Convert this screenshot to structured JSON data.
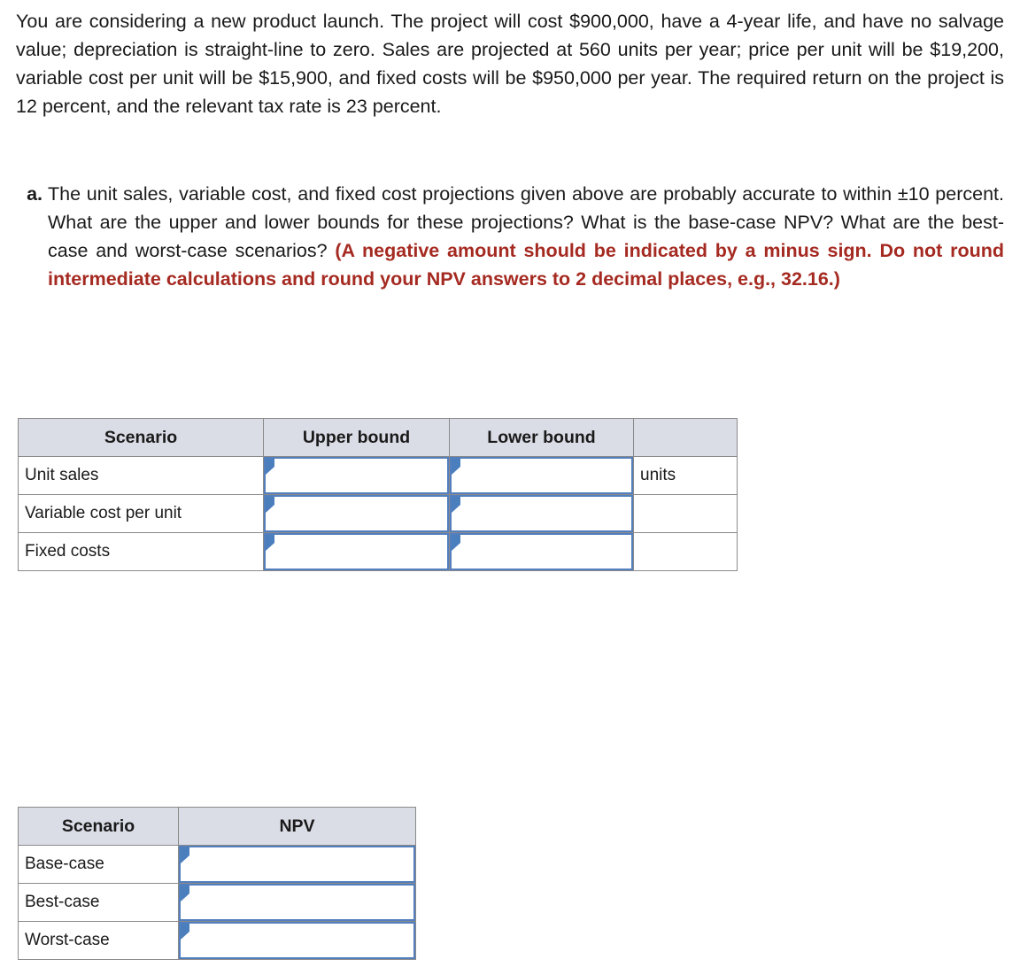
{
  "intro": {
    "text": "You are considering a new product launch. The project will cost $900,000, have a 4-year life, and have no salvage value; depreciation is straight-line to zero. Sales are projected at 560 units per year; price per unit will be $19,200, variable cost per unit will be $15,900, and fixed costs will be $950,000 per year. The required return on the project is 12 percent, and the relevant tax rate is 23 percent."
  },
  "question": {
    "label": "a.",
    "body": "The unit sales, variable cost, and fixed cost projections given above are probably accurate to within ±10 percent. What are the upper and lower bounds for these projections? What is the base-case NPV? What are the best-case and worst-case scenarios? ",
    "hint": "(A negative amount should be indicated by a minus sign. Do not round intermediate calculations and round your NPV answers to 2 decimal places, e.g., 32.16.)"
  },
  "bounds_table": {
    "headers": [
      "Scenario",
      "Upper bound",
      "Lower bound",
      ""
    ],
    "rows": [
      {
        "scenario": "Unit sales",
        "upper": "",
        "lower": "",
        "unit": "units"
      },
      {
        "scenario": "Variable cost per unit",
        "upper": "",
        "lower": "",
        "unit": ""
      },
      {
        "scenario": "Fixed costs",
        "upper": "",
        "lower": "",
        "unit": ""
      }
    ]
  },
  "npv_table": {
    "headers": [
      "Scenario",
      "NPV"
    ],
    "rows": [
      {
        "scenario": "Base-case",
        "npv": ""
      },
      {
        "scenario": "Best-case",
        "npv": ""
      },
      {
        "scenario": "Worst-case",
        "npv": ""
      }
    ]
  },
  "colors": {
    "header_background": "#dadde6",
    "input_border": "#537fbe",
    "input_flag": "#4b7ebd",
    "hint_text": "#a52a21",
    "body_text": "#1a1a1a",
    "table_border": "#8a8a8a"
  }
}
